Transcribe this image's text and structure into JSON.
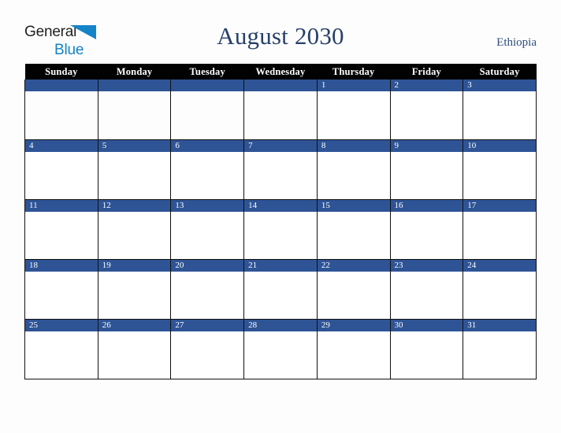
{
  "brand": {
    "logo_text_top": "General",
    "logo_text_bottom": "Blue",
    "logo_top_color": "#231f20",
    "logo_bottom_color": "#1583c8",
    "triangle_color": "#1583c8",
    "triangle_icon": "triangle-icon"
  },
  "header": {
    "title": "August 2030",
    "country": "Ethiopia",
    "title_color": "#27406b",
    "country_color": "#2e4d7b"
  },
  "calendar": {
    "month": "August",
    "year": "2030",
    "header_background": "#020202",
    "header_text_color": "#ffffff",
    "day_band_color": "#2e5496",
    "day_number_color": "#ffffff",
    "cell_background": "#ffffff",
    "grid_line_color": "#111111",
    "weekdays": [
      "Sunday",
      "Monday",
      "Tuesday",
      "Wednesday",
      "Thursday",
      "Friday",
      "Saturday"
    ],
    "weeks": [
      [
        "",
        "",
        "",
        "",
        "1",
        "2",
        "3"
      ],
      [
        "4",
        "5",
        "6",
        "7",
        "8",
        "9",
        "10"
      ],
      [
        "11",
        "12",
        "13",
        "14",
        "15",
        "16",
        "17"
      ],
      [
        "18",
        "19",
        "20",
        "21",
        "22",
        "23",
        "24"
      ],
      [
        "25",
        "26",
        "27",
        "28",
        "29",
        "30",
        "31"
      ]
    ]
  },
  "page": {
    "background": "#fdfdfd"
  }
}
